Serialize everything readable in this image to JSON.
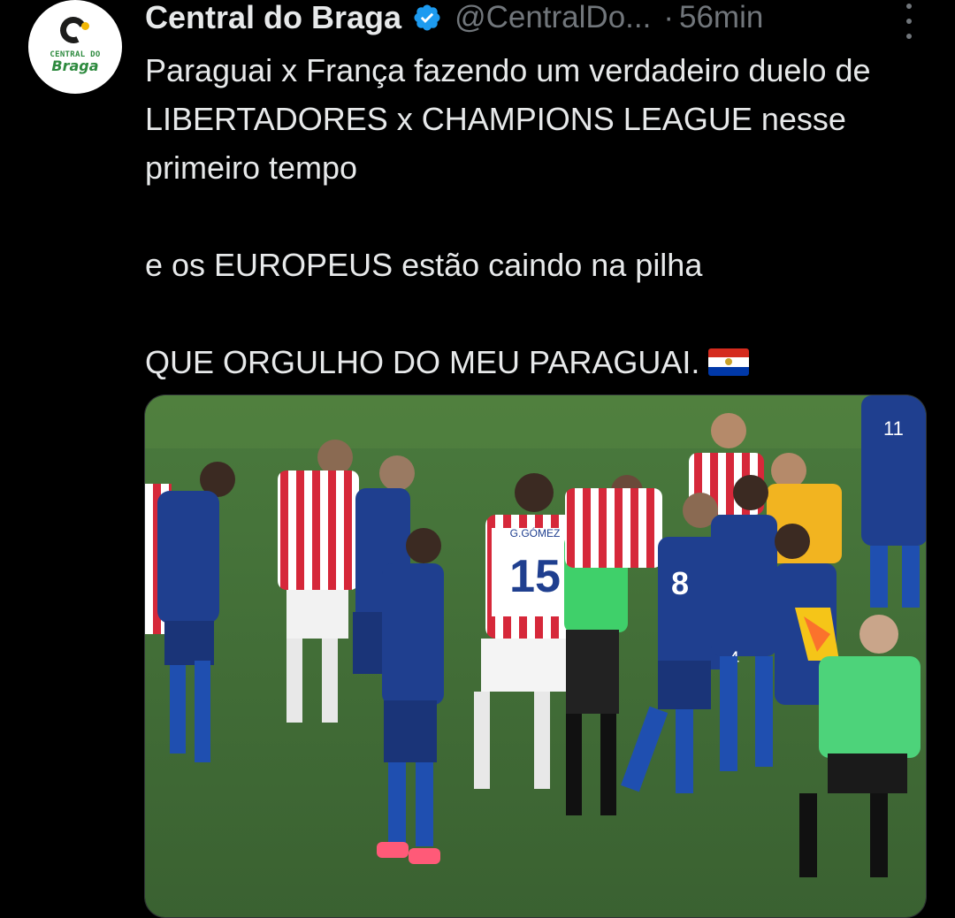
{
  "account": {
    "display_name": "Central do Braga",
    "handle": "@CentralDo...",
    "separator": "·",
    "time": "56min",
    "verified": true,
    "avatar_text_top": "CENTRAL DO",
    "avatar_text_bottom": "Braga"
  },
  "tweet": {
    "lines": [
      "Paraguai x França fazendo um verdadeiro duelo de LIBERTADORES x CHAMPIONS LEAGUE nesse primeiro tempo",
      "e os EUROPEUS estão caindo na pilha",
      "QUE ORGULHO DO MEU PARAGUAI."
    ],
    "flag_emoji": "paraguay-flag"
  },
  "media": {
    "description_icon": "photo",
    "jersey_name": "G.GÓMEZ",
    "jersey_number": "15",
    "numbers": [
      "11",
      "8",
      "4"
    ]
  },
  "colors": {
    "background": "#000000",
    "text_primary": "#e7e9ea",
    "text_secondary": "#71767b",
    "verified_blue": "#1d9bf0",
    "pitch_green": "#3f6b35"
  }
}
